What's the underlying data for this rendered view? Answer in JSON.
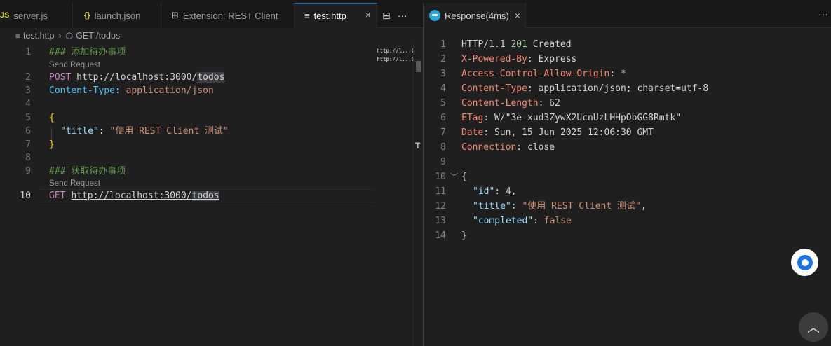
{
  "left_tabs": [
    {
      "icon": "JS",
      "label": "server.js"
    },
    {
      "icon": "{}",
      "label": "launch.json"
    },
    {
      "icon": "⊞",
      "label": "Extension: REST Client"
    },
    {
      "icon": "≡",
      "label": "test.http"
    }
  ],
  "left_actions": {
    "split": "⊟",
    "more": "···"
  },
  "breadcrumb": {
    "file": "test.http",
    "symbol": "GET /todos"
  },
  "editor": {
    "lens1": "Send Request",
    "lens2": "Send Request",
    "lines": {
      "l1": "### 添加待办事项",
      "l2_method": "POST",
      "l2_url": "http://localhost:3000/",
      "l2_url_hl": "todos",
      "l3_key": "Content-Type:",
      "l3_val": "application/json",
      "l5": "{",
      "l6_key": "\"title\"",
      "l6_colon": ": ",
      "l6_val": "\"使用 REST Client 测试\"",
      "l7": "}",
      "l9": "### 获取待办事项",
      "l10_method": "GET",
      "l10_url": "http://localhost:3000/",
      "l10_url_hl": "todos"
    },
    "line_numbers": [
      "1",
      "2",
      "3",
      "4",
      "5",
      "6",
      "7",
      "8",
      "9",
      "10"
    ]
  },
  "minimap": {
    "line1": "http://l...0",
    "line2": "http://l...0"
  },
  "response_tab": {
    "label": "Response(4ms)",
    "close": "×",
    "more": "···"
  },
  "response": {
    "line_numbers": [
      "1",
      "2",
      "3",
      "4",
      "5",
      "6",
      "7",
      "8",
      "9",
      "10",
      "11",
      "12",
      "13",
      "14"
    ],
    "status_proto": "HTTP/1.1",
    "status_code": "201",
    "status_text": "Created",
    "headers": [
      {
        "k": "X-Powered-By",
        "v": "Express"
      },
      {
        "k": "Access-Control-Allow-Origin",
        "v": "*"
      },
      {
        "k": "Content-Type",
        "v": "application/json; charset=utf-8"
      },
      {
        "k": "Content-Length",
        "v": "62"
      },
      {
        "k": "ETag",
        "v": "W/\"3e-xud3ZywX2UcnUzLHHpObGG8Rmtk\""
      },
      {
        "k": "Date",
        "v": "Sun, 15 Jun 2025 12:06:30 GMT"
      },
      {
        "k": "Connection",
        "v": "close"
      }
    ],
    "body_open": "{",
    "id_key": "\"id\"",
    "id_val": "4",
    "title_key": "\"title\"",
    "title_val": "\"使用 REST Client 测试\"",
    "completed_key": "\"completed\"",
    "completed_val": "false",
    "body_close": "}"
  },
  "fab_up": "︿",
  "colors": {
    "accent": "#0078d4",
    "assistant": "#1a73e8"
  }
}
